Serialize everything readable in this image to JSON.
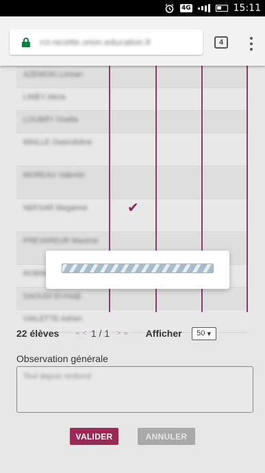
{
  "statusbar": {
    "network": "4G",
    "time": "15:11"
  },
  "browser": {
    "url": "rct-recette.orion.education.fr",
    "tab_count": "4"
  },
  "students": [
    {
      "name": "AZEMOKI Lorean"
    },
    {
      "name": "LIMEY Alicia"
    },
    {
      "name": "LOUBRY Onella"
    },
    {
      "name": "MAILLE Gwendoline"
    },
    {
      "name": "MOREAU Valentin"
    },
    {
      "name": "NEFSAR Meganne"
    },
    {
      "name": "PREVAREUR Maxime"
    },
    {
      "name": "ROBINET Louise"
    },
    {
      "name": "SAOUDI El-Hadji"
    },
    {
      "name": "VIALETTE Adrien"
    }
  ],
  "checkmark": "✔",
  "loading": {
    "progress": "indeterminate"
  },
  "pager": {
    "count": "22 élèves",
    "first": "«",
    "prev": "<",
    "page": "1 / 1",
    "next": ">",
    "last": "»",
    "afficher": "Afficher",
    "per_page": "50"
  },
  "observation": {
    "label": "Observation générale",
    "value": "Tout depuis renforcé"
  },
  "buttons": {
    "valider": "VALIDER",
    "annuler": "ANNULER"
  },
  "colors": {
    "accent": "#9a2a55",
    "column_line": "#8a3a6c",
    "secure_lock": "#0b8043"
  }
}
